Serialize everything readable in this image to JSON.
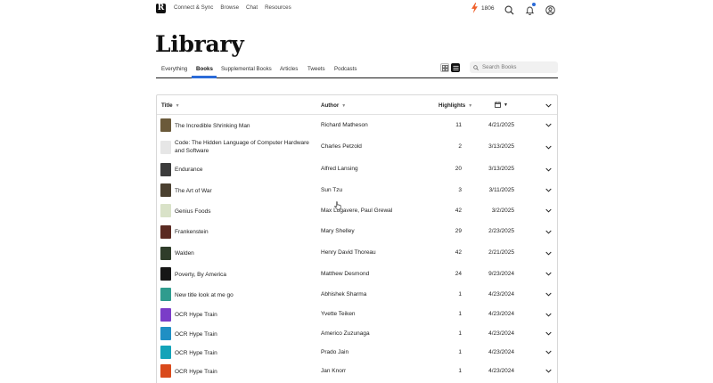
{
  "brand": {
    "logo_letter": "R"
  },
  "nav": {
    "links": [
      "Connect & Sync",
      "Browse",
      "Chat",
      "Resources"
    ],
    "streak_count": "1806"
  },
  "page": {
    "title": "Library"
  },
  "tabs": [
    {
      "label": "Everything",
      "active": false
    },
    {
      "label": "Books",
      "active": true
    },
    {
      "label": "Supplemental Books",
      "active": false
    },
    {
      "label": "Articles",
      "active": false
    },
    {
      "label": "Tweets",
      "active": false
    },
    {
      "label": "Podcasts",
      "active": false
    }
  ],
  "search": {
    "placeholder": "Search Books"
  },
  "table": {
    "headers": {
      "title": "Title",
      "author": "Author",
      "highlights": "Highlights"
    },
    "rows": [
      {
        "title": "The Incredible Shrinking Man",
        "author": "Richard Matheson",
        "highlights": "11",
        "date": "4/21/2025",
        "cover": "#6b5a3a"
      },
      {
        "title": "Code: The Hidden Language of Computer Hardware and Software",
        "author": "Charles Petzold",
        "highlights": "2",
        "date": "3/13/2025",
        "cover": "#e6e6e6"
      },
      {
        "title": "Endurance",
        "author": "Alfred Lansing",
        "highlights": "20",
        "date": "3/13/2025",
        "cover": "#3c3c3c"
      },
      {
        "title": "The Art of War",
        "author": "Sun Tzu",
        "highlights": "3",
        "date": "3/11/2025",
        "cover": "#4a4030"
      },
      {
        "title": "Genius Foods",
        "author": "Max Lugavere, Paul Grewal",
        "highlights": "42",
        "date": "3/2/2025",
        "cover": "#d9e2c8"
      },
      {
        "title": "Frankenstein",
        "author": "Mary Shelley",
        "highlights": "29",
        "date": "2/23/2025",
        "cover": "#5a2a22"
      },
      {
        "title": "Walden",
        "author": "Henry David Thoreau",
        "highlights": "42",
        "date": "2/21/2025",
        "cover": "#2f3d2a"
      },
      {
        "title": "Poverty, By America",
        "author": "Matthew Desmond",
        "highlights": "24",
        "date": "9/23/2024",
        "cover": "#161616"
      },
      {
        "title": "New title look at me go",
        "author": "Abhishek Sharma",
        "highlights": "1",
        "date": "4/23/2024",
        "cover": "#2f9c8e"
      },
      {
        "title": "OCR Hype Train",
        "author": "Yvette Teiken",
        "highlights": "1",
        "date": "4/23/2024",
        "cover": "#7a3cc8"
      },
      {
        "title": "OCR Hype Train",
        "author": "Americo Zuzunaga",
        "highlights": "1",
        "date": "4/23/2024",
        "cover": "#1f8fc4"
      },
      {
        "title": "OCR Hype Train",
        "author": "Prado Jain",
        "highlights": "1",
        "date": "4/23/2024",
        "cover": "#13a3b8"
      },
      {
        "title": "OCR Hype Train",
        "author": "Jan Knorr",
        "highlights": "1",
        "date": "4/23/2024",
        "cover": "#d94a1c"
      }
    ]
  },
  "colors": {
    "accent": "#2b6bd8",
    "streak": "#f0622d",
    "text": "#1a1a1a"
  },
  "icons": {
    "streak": "lightning-icon",
    "search": "search-icon",
    "notifications": "bell-icon",
    "account": "user-icon",
    "sort": "calendar-icon"
  }
}
